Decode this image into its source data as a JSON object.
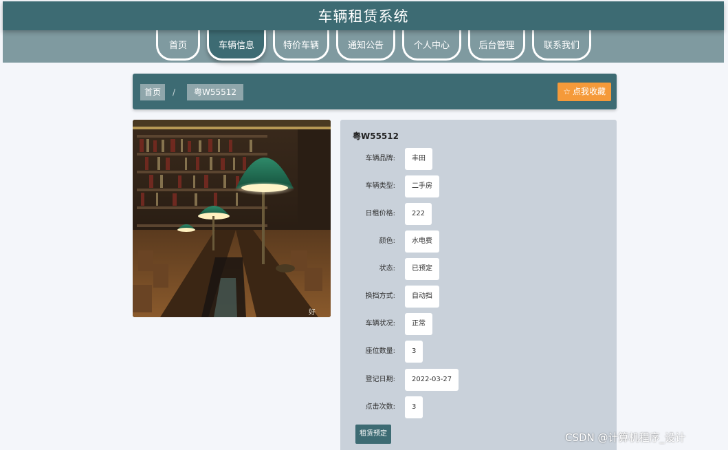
{
  "header": {
    "title": "车辆租赁系统"
  },
  "nav": {
    "items": [
      {
        "label": "首页"
      },
      {
        "label": "车辆信息"
      },
      {
        "label": "特价车辆"
      },
      {
        "label": "通知公告"
      },
      {
        "label": "个人中心"
      },
      {
        "label": "后台管理"
      },
      {
        "label": "联系我们"
      }
    ],
    "active_index": 1
  },
  "breadcrumb": {
    "home": "首页",
    "separator": "/",
    "current": "粤W55512"
  },
  "favorite_button": {
    "icon": "star-outline-icon",
    "label": "点我收藏"
  },
  "image": {
    "description_icon": "library-photo",
    "corner_text": "好"
  },
  "detail": {
    "title": "粤W55512",
    "fields": [
      {
        "label": "车辆品牌:",
        "value": "丰田"
      },
      {
        "label": "车辆类型:",
        "value": "二手房"
      },
      {
        "label": "日租价格:",
        "value": "222"
      },
      {
        "label": "颜色:",
        "value": "水电费"
      },
      {
        "label": "状态:",
        "value": "已预定"
      },
      {
        "label": "换挡方式:",
        "value": "自动挡"
      },
      {
        "label": "车辆状况:",
        "value": "正常"
      },
      {
        "label": "座位数量:",
        "value": "3"
      },
      {
        "label": "登记日期:",
        "value": "2022-03-27"
      },
      {
        "label": "点击次数:",
        "value": "3"
      }
    ],
    "rent_button": "租赁预定"
  },
  "watermark": "CSDN @计算机程序_设计",
  "colors": {
    "primary": "#3d6b73",
    "nav_bar": "#7f9aa0",
    "accent_orange": "#f59a3a",
    "panel": "#c9d1da",
    "page_bg": "#f4f6fa"
  }
}
